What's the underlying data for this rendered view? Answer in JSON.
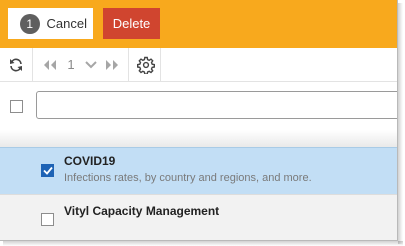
{
  "actions": {
    "selected_count": "1",
    "cancel_label": "Cancel",
    "delete_label": "Delete"
  },
  "toolbar": {
    "refresh_icon": "refresh-icon",
    "first_page_icon": "first-page-icon",
    "page_number": "1",
    "page_dropdown_icon": "chevron-down-icon",
    "last_page_icon": "last-page-icon",
    "settings_icon": "gear-icon"
  },
  "search": {
    "value": "",
    "placeholder": ""
  },
  "items": [
    {
      "title": "COVID19",
      "description": "Infections rates, by country and regions, and more.",
      "checked": true
    },
    {
      "title": "Vityl Capacity Management",
      "description": "",
      "checked": false
    }
  ],
  "colors": {
    "action_bar": "#f8a91d",
    "delete_button": "#d0452f",
    "selected_row": "#c2def5",
    "checkbox_checked": "#1e63b5"
  }
}
